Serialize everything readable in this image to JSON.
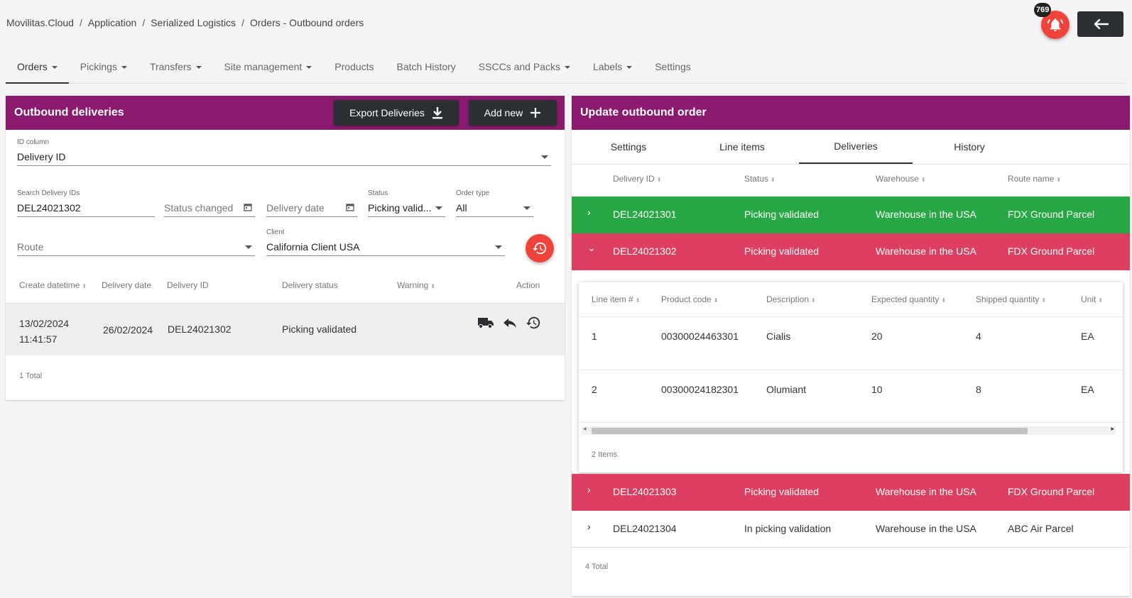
{
  "breadcrumb": [
    "Movilitas.Cloud",
    "Application",
    "Serialized Logistics",
    "Orders - Outbound orders"
  ],
  "notifications": {
    "count": "769"
  },
  "main_tabs": [
    {
      "label": "Orders",
      "dropdown": true,
      "active": true
    },
    {
      "label": "Pickings",
      "dropdown": true
    },
    {
      "label": "Transfers",
      "dropdown": true
    },
    {
      "label": "Site management",
      "dropdown": true
    },
    {
      "label": "Products",
      "dropdown": false
    },
    {
      "label": "Batch History",
      "dropdown": false
    },
    {
      "label": "SSCCs and Packs",
      "dropdown": true
    },
    {
      "label": "Labels",
      "dropdown": true
    },
    {
      "label": "Settings",
      "dropdown": false
    }
  ],
  "left": {
    "title": "Outbound deliveries",
    "export_label": "Export Deliveries",
    "add_label": "Add new",
    "id_column": {
      "label": "ID column",
      "value": "Delivery ID"
    },
    "search": {
      "label": "Search Delivery IDs",
      "value": "DEL24021302"
    },
    "status_changed": {
      "placeholder": "Status changed"
    },
    "delivery_date": {
      "placeholder": "Delivery date"
    },
    "status": {
      "label": "Status",
      "value": "Picking valid..."
    },
    "order_type": {
      "label": "Order type",
      "value": "All"
    },
    "route": {
      "placeholder": "Route"
    },
    "client": {
      "label": "Client",
      "value": "California Client USA"
    },
    "columns": [
      "Create datetime",
      "Delivery date",
      "Delivery ID",
      "Delivery status",
      "Warning",
      "Action"
    ],
    "row": {
      "create_date": "13/02/2024",
      "create_time": "11:41:57",
      "delivery_date": "26/02/2024",
      "delivery_id": "DEL24021302",
      "status": "Picking validated"
    },
    "total": "1 Total"
  },
  "right": {
    "title": "Update outbound order",
    "tabs": [
      "Settings",
      "Line items",
      "Deliveries",
      "History"
    ],
    "active_tab": "Deliveries",
    "columns": [
      "Delivery ID",
      "Status",
      "Warehouse",
      "Route name"
    ],
    "rows": [
      {
        "id": "DEL24021301",
        "status": "Picking validated",
        "warehouse": "Warehouse in the USA",
        "route": "FDX Ground Parcel"
      },
      {
        "id": "DEL24021302",
        "status": "Picking validated",
        "warehouse": "Warehouse in the USA",
        "route": "FDX Ground Parcel"
      },
      {
        "id": "DEL24021303",
        "status": "Picking validated",
        "warehouse": "Warehouse in the USA",
        "route": "FDX Ground Parcel"
      },
      {
        "id": "DEL24021304",
        "status": "In picking validation",
        "warehouse": "Warehouse in the USA",
        "route": "ABC Air Parcel"
      }
    ],
    "inner": {
      "columns": [
        "Line item #",
        "Product code",
        "Description",
        "Expected quantity",
        "Shipped quantity",
        "Unit"
      ],
      "rows": [
        {
          "line": "1",
          "code": "00300024463301",
          "desc": "Cialis",
          "expected": "20",
          "shipped": "4",
          "unit": "EA"
        },
        {
          "line": "2",
          "code": "00300024182301",
          "desc": "Olumiant",
          "expected": "10",
          "shipped": "8",
          "unit": "EA"
        }
      ],
      "total": "2 Items"
    },
    "total": "4 Total"
  },
  "colors": {
    "header": "#8a1a6e",
    "green": "#28a745",
    "red": "#dc3f62",
    "accent": "#f0433a",
    "dark": "#2b2f33"
  }
}
